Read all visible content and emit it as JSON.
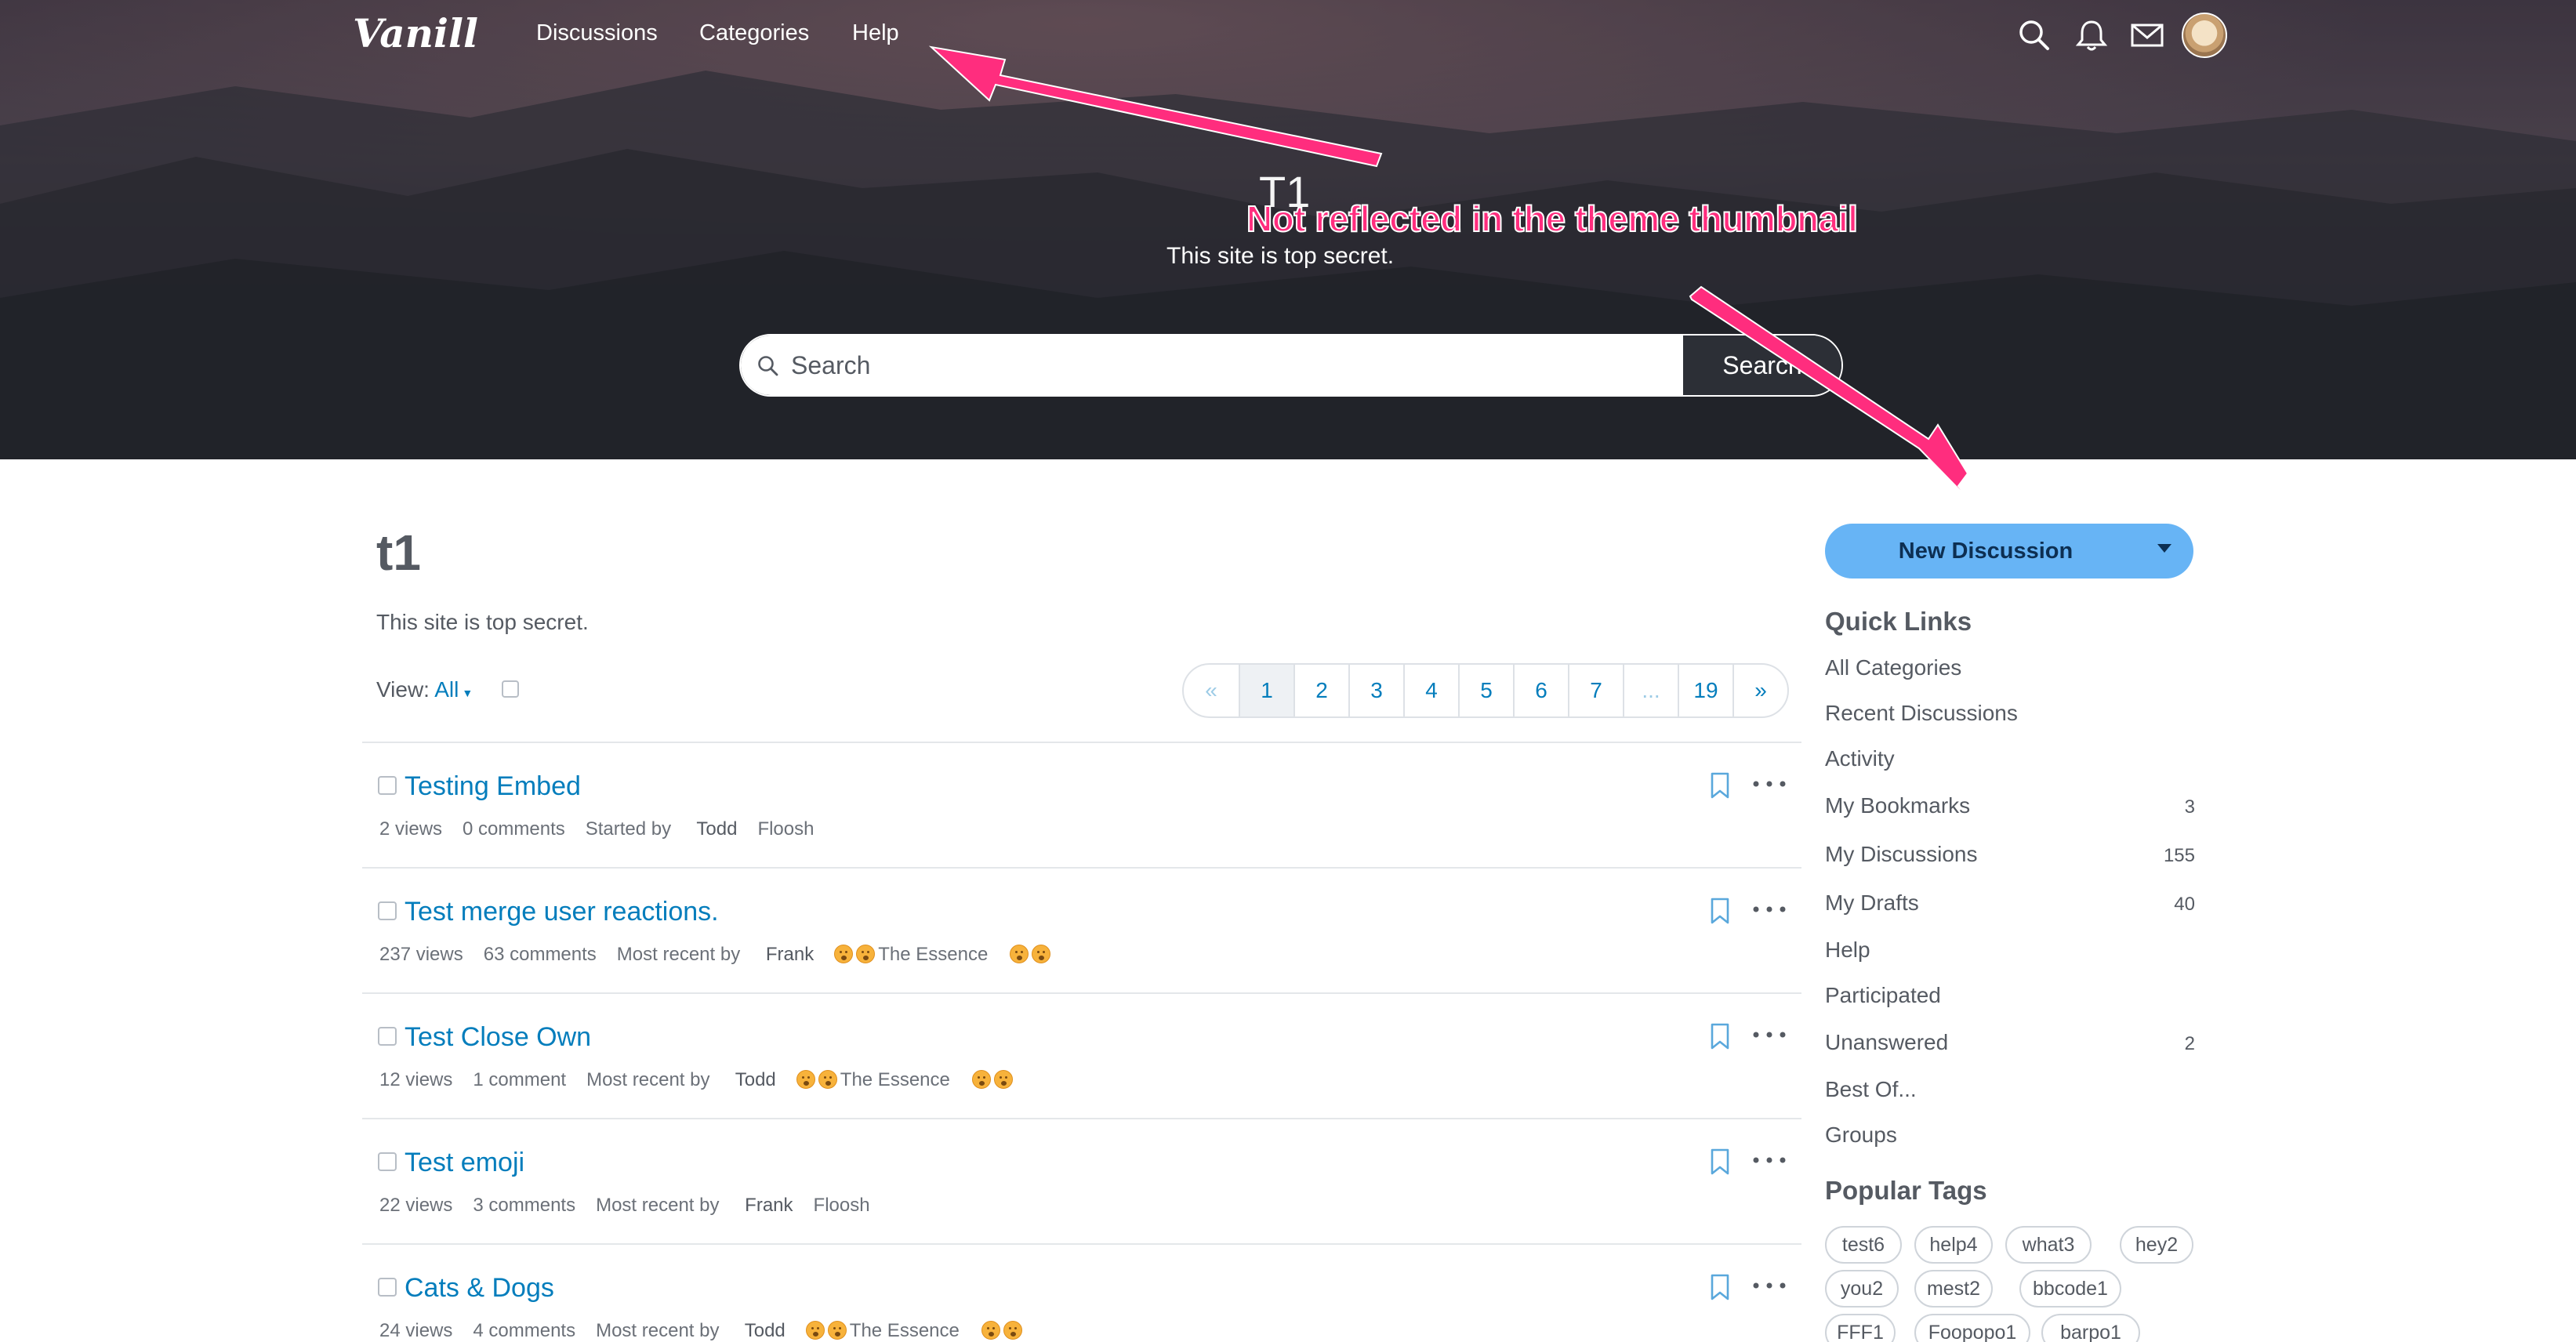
{
  "header": {
    "logo_text": "Vanilla",
    "nav": [
      "Discussions",
      "Categories",
      "Help"
    ],
    "icons": [
      "search-icon",
      "bell-icon",
      "envelope-icon",
      "avatar"
    ]
  },
  "hero": {
    "site_title": "T1",
    "site_description": "This site is top secret.",
    "search_placeholder": "Search",
    "search_button": "Search",
    "annotation": "Not reflected in the  theme thumbnail"
  },
  "main": {
    "title": "t1",
    "description": "This site is top secret.",
    "view_label": "View:",
    "view_value": "All",
    "pager": [
      "«",
      "1",
      "2",
      "3",
      "4",
      "5",
      "6",
      "7",
      "...",
      "19",
      "»"
    ],
    "pager_active": "1",
    "discussions": [
      {
        "title": "Testing Embed",
        "views": "2 views",
        "comments": "0 comments",
        "recent_label": "Started by",
        "author": "Todd",
        "category": "Floosh",
        "emoji_category": false
      },
      {
        "title": "Test merge user reactions.",
        "views": "237 views",
        "comments": "63 comments",
        "recent_label": "Most recent by",
        "author": "Frank",
        "category": "The Essence",
        "emoji_category": true
      },
      {
        "title": "Test Close Own",
        "views": "12 views",
        "comments": "1 comment",
        "recent_label": "Most recent by",
        "author": "Todd",
        "category": "The Essence",
        "emoji_category": true
      },
      {
        "title": "Test emoji",
        "views": "22 views",
        "comments": "3 comments",
        "recent_label": "Most recent by",
        "author": "Frank",
        "category": "Floosh",
        "emoji_category": false
      },
      {
        "title": "Cats & Dogs",
        "views": "24 views",
        "comments": "4 comments",
        "recent_label": "Most recent by",
        "author": "Todd",
        "category": "The Essence",
        "emoji_category": true
      }
    ]
  },
  "sidebar": {
    "new_discussion": "New Discussion",
    "quick_links_title": "Quick Links",
    "quick_links": [
      {
        "label": "All Categories",
        "count": ""
      },
      {
        "label": "Recent Discussions",
        "count": ""
      },
      {
        "label": "Activity",
        "count": ""
      },
      {
        "label": "My Bookmarks",
        "count": "3"
      },
      {
        "label": "My Discussions",
        "count": "155"
      },
      {
        "label": "My Drafts",
        "count": "40"
      },
      {
        "label": "Help",
        "count": ""
      },
      {
        "label": "Participated",
        "count": ""
      },
      {
        "label": "Unanswered",
        "count": "2"
      },
      {
        "label": "Best Of...",
        "count": ""
      },
      {
        "label": "Groups",
        "count": ""
      }
    ],
    "popular_tags_title": "Popular Tags",
    "tags": [
      "test6",
      "help4",
      "what3",
      "hey2",
      "you2",
      "mest2",
      "bbcode1",
      "FFF1",
      "Foopopo1",
      "barpo1"
    ]
  },
  "colors": {
    "link": "#037dbc",
    "button_bg": "#67b4f5",
    "annotation": "#ff2d7e"
  }
}
